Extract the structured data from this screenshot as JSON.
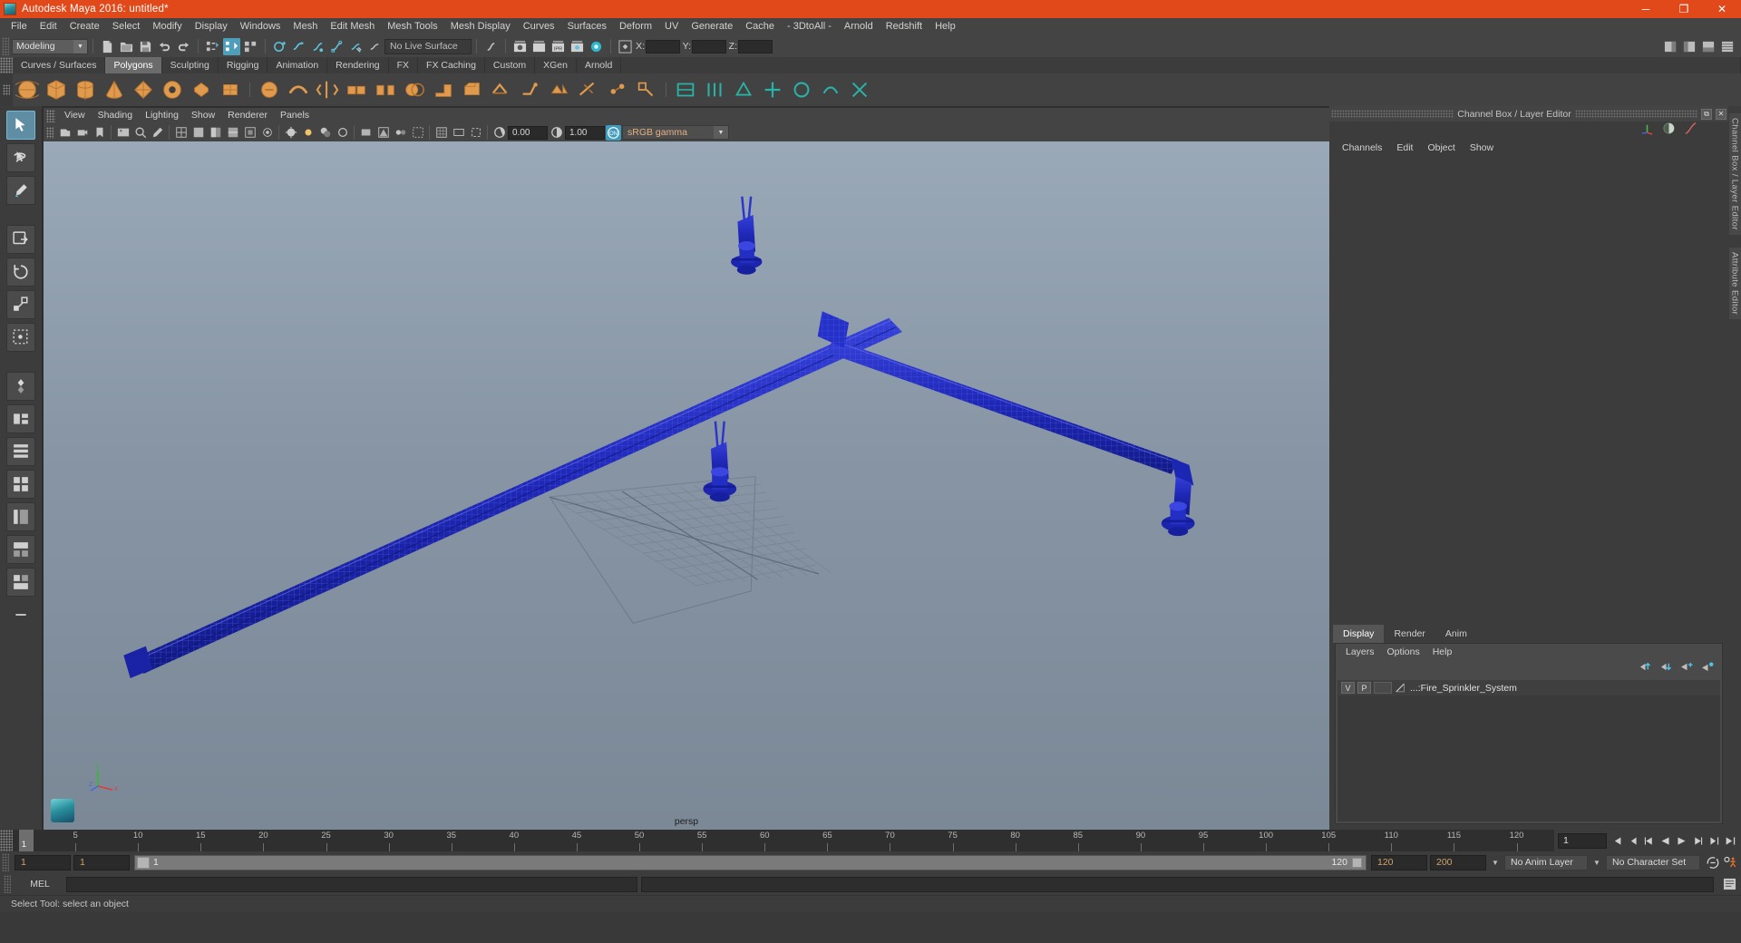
{
  "window": {
    "title": "Autodesk Maya 2016: untitled*",
    "app_icon": "maya-logo-icon",
    "controls": {
      "minimize": "─",
      "maximize": "❐",
      "close": "✕"
    },
    "title_bar_color": "#e2491a"
  },
  "menubar": {
    "items": [
      "File",
      "Edit",
      "Create",
      "Select",
      "Modify",
      "Display",
      "Windows",
      "Mesh",
      "Edit Mesh",
      "Mesh Tools",
      "Mesh Display",
      "Curves",
      "Surfaces",
      "Deform",
      "UV",
      "Generate",
      "Cache",
      "- 3DtoAll -",
      "Arnold",
      "Redshift",
      "Help"
    ]
  },
  "statusline": {
    "menuset": "Modeling",
    "live_surface": "No Live Surface",
    "coords": [
      {
        "label": "X:",
        "value": ""
      },
      {
        "label": "Y:",
        "value": ""
      },
      {
        "label": "Z:",
        "value": ""
      }
    ]
  },
  "shelf": {
    "tabs": [
      {
        "label": "Curves / Surfaces",
        "active": false
      },
      {
        "label": "Polygons",
        "active": true
      },
      {
        "label": "Sculpting",
        "active": false
      },
      {
        "label": "Rigging",
        "active": false
      },
      {
        "label": "Animation",
        "active": false
      },
      {
        "label": "Rendering",
        "active": false
      },
      {
        "label": "FX",
        "active": false
      },
      {
        "label": "FX Caching",
        "active": false
      },
      {
        "label": "Custom",
        "active": false
      },
      {
        "label": "XGen",
        "active": false
      },
      {
        "label": "Arnold",
        "active": false
      }
    ],
    "icons": [
      "poly-sphere-icon",
      "poly-cube-icon",
      "poly-cylinder-icon",
      "poly-cone-icon",
      "poly-torus-icon",
      "poly-plane-icon",
      "poly-disc-icon",
      "poly-platonic-icon",
      "sculpt-sphere-icon",
      "smooth-icon",
      "mirror-icon",
      "combine-icon",
      "separate-icon",
      "booleans-icon",
      "extrude-icon",
      "bevel-icon",
      "bridge-icon",
      "append-icon",
      "wedge-icon",
      "multicut-icon",
      "target-weld-icon",
      "quad-draw-icon",
      "uv-green-1-icon",
      "uv-green-2-icon",
      "uv-green-3-icon",
      "uv-green-4-icon",
      "uv-green-5-icon",
      "uv-green-6-icon",
      "uv-cut-icon"
    ]
  },
  "toolbox": {
    "tools": [
      "select-tool-icon",
      "lasso-select-icon",
      "paint-select-icon",
      "move-tool-icon",
      "rotate-tool-icon",
      "scale-tool-icon",
      "last-tool-icon",
      "snap-icon",
      "layout-single-icon",
      "layout-four-icon",
      "layout-three-icon",
      "layout-persp-outliner-icon",
      "layout-hypershade-icon",
      "layout-hypergraph-icon",
      "more-layouts-icon"
    ],
    "selected": "select-tool-icon"
  },
  "viewport": {
    "menus": [
      "View",
      "Shading",
      "Lighting",
      "Show",
      "Renderer",
      "Panels"
    ],
    "camera_label": "persp",
    "toolbar": {
      "exposure": "0.00",
      "gamma": "1.00",
      "color_management_toggle": "ON",
      "color_profile": "sRGB gamma"
    },
    "axis_labels": {
      "y": "Y",
      "x": "X",
      "z": "Z"
    },
    "scene_description": "Blue wireframe fire sprinkler pipe system with three sprinkler heads on a grid"
  },
  "channel_box": {
    "panel_title": "Channel Box / Layer Editor",
    "menus": [
      "Channels",
      "Edit",
      "Object",
      "Show"
    ],
    "header_icons": [
      "transform-axes-icon",
      "shading-sphere-icon",
      "anim-curve-icon"
    ],
    "window_buttons": {
      "float": "⧉",
      "close": "✕"
    }
  },
  "layer_editor": {
    "tabs": [
      {
        "label": "Display",
        "active": true
      },
      {
        "label": "Render",
        "active": false
      },
      {
        "label": "Anim",
        "active": false
      }
    ],
    "menus": [
      "Layers",
      "Options",
      "Help"
    ],
    "buttons": [
      "move-layer-up-icon",
      "move-layer-down-icon",
      "new-layer-icon",
      "new-layer-from-selected-icon"
    ],
    "layers": [
      {
        "visibility": "V",
        "playback": "P",
        "shading": "",
        "name": "...:Fire_Sprinkler_System"
      }
    ]
  },
  "side_tabs": [
    "Channel Box / Layer Editor",
    "Attribute Editor"
  ],
  "timeline": {
    "ticks": [
      5,
      10,
      15,
      20,
      25,
      30,
      35,
      40,
      45,
      50,
      55,
      60,
      65,
      70,
      75,
      80,
      85,
      90,
      95,
      100,
      105,
      110,
      115,
      120
    ],
    "current_frame": "1",
    "current_frame_field": "1",
    "playback_buttons": [
      "go-to-start-icon",
      "step-back-key-icon",
      "step-back-frame-icon",
      "play-backwards-icon",
      "play-forwards-icon",
      "step-forward-frame-icon",
      "step-forward-key-icon",
      "go-to-end-icon"
    ]
  },
  "range_slider": {
    "anim_start": "1",
    "range_start": "1",
    "range_bar_left_label": "1",
    "range_bar_right_label": "120",
    "range_end": "120",
    "anim_end": "200",
    "anim_layer": "No Anim Layer",
    "character_set": "No Character Set",
    "auto_key_icon": "auto-keyframe-icon",
    "anim_prefs_icon": "animation-preferences-icon"
  },
  "command_line": {
    "label": "MEL",
    "input_value": "",
    "output_value": "",
    "script_editor_icon": "script-editor-icon"
  },
  "help_line": {
    "text": "Select Tool: select an object"
  },
  "colors": {
    "accent_orange": "#e2491a",
    "panel_bg": "#3c3c3c",
    "toolbar_bg": "#444444",
    "viewport_top": "#9aa9b8",
    "viewport_bottom": "#7b8896",
    "model_blue": "#1f2ab0",
    "active_tab": "#6b6b6b",
    "highlight_teal": "#3f9bbd"
  }
}
